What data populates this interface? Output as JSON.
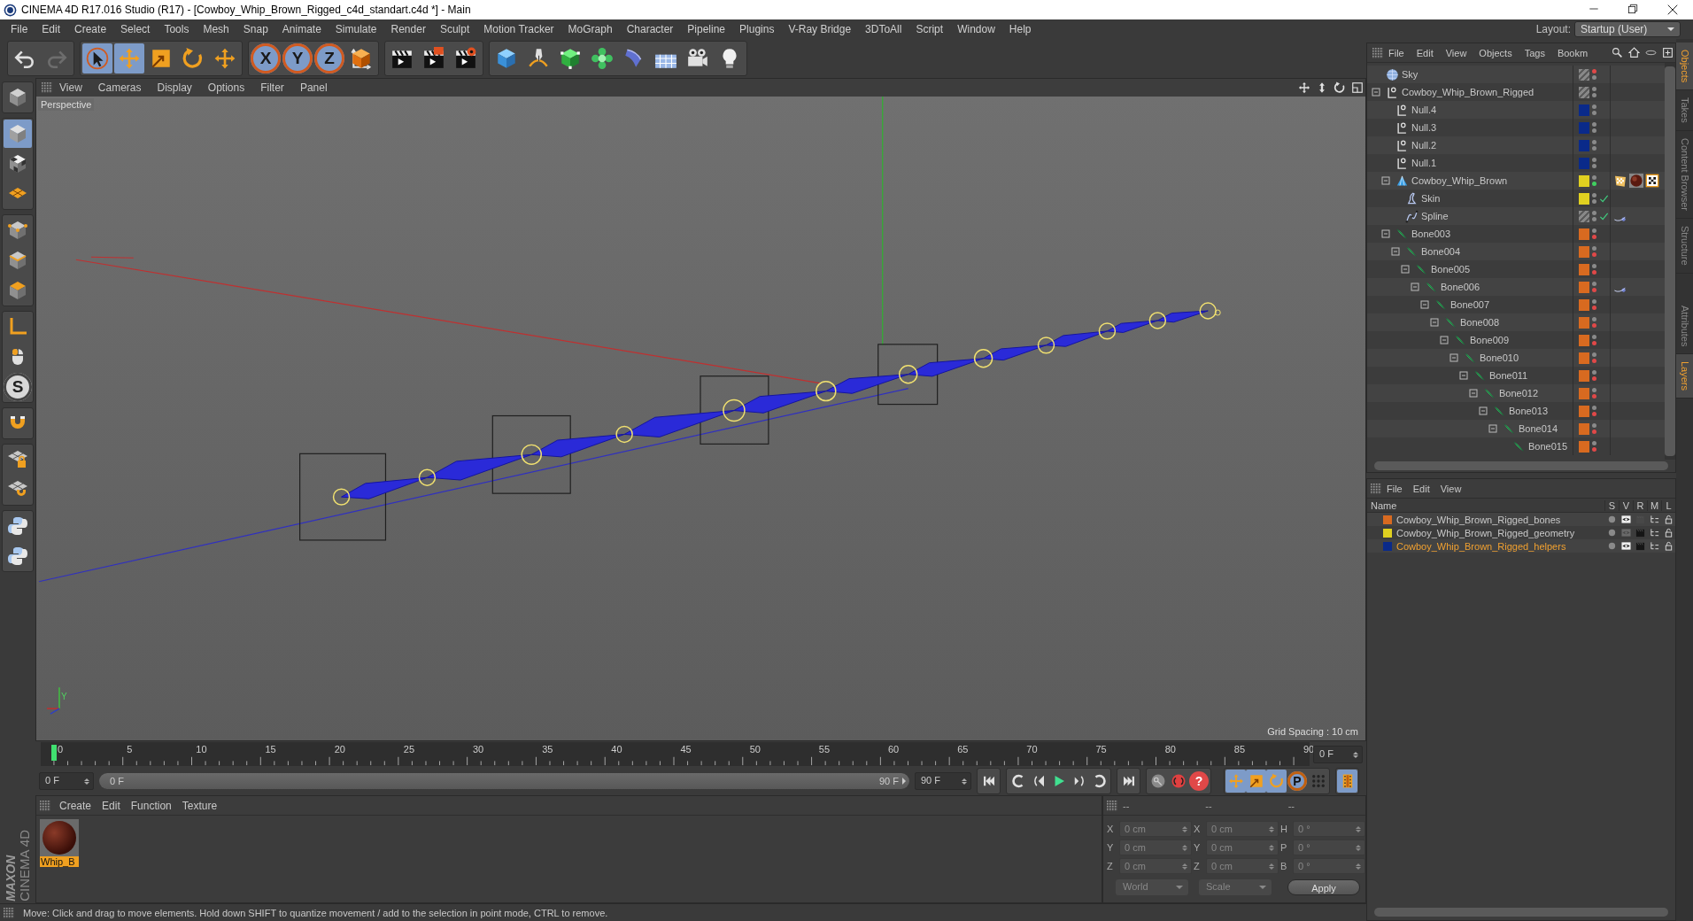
{
  "window": {
    "title": "CINEMA 4D R17.016 Studio (R17) - [Cowboy_Whip_Brown_Rigged_c4d_standart.c4d *] - Main"
  },
  "menu_bar": [
    "File",
    "Edit",
    "Create",
    "Select",
    "Tools",
    "Mesh",
    "Snap",
    "Animate",
    "Simulate",
    "Render",
    "Sculpt",
    "Motion Tracker",
    "MoGraph",
    "Character",
    "Pipeline",
    "Plugins",
    "V-Ray Bridge",
    "3DToAll",
    "Script",
    "Window",
    "Help"
  ],
  "layout": {
    "label": "Layout:",
    "value": "Startup (User)"
  },
  "toolbar": [
    [
      {
        "kind": "undo",
        "disabled": false
      },
      {
        "kind": "redo",
        "disabled": true
      }
    ],
    [
      {
        "kind": "select",
        "selected": true
      },
      {
        "kind": "move",
        "selected": true
      },
      {
        "kind": "scale",
        "selected": false
      },
      {
        "kind": "rotate",
        "selected": false
      },
      {
        "kind": "transform",
        "selected": false
      }
    ],
    [
      {
        "kind": "axislock",
        "label": "X",
        "selected": true
      },
      {
        "kind": "axislock",
        "label": "Y",
        "selected": true
      },
      {
        "kind": "axislock",
        "label": "Z",
        "selected": true
      },
      {
        "kind": "coords",
        "selected": false
      }
    ],
    [
      {
        "kind": "renderview"
      },
      {
        "kind": "renderpicture"
      },
      {
        "kind": "rendersettings"
      }
    ],
    [
      {
        "kind": "cube"
      },
      {
        "kind": "pen"
      },
      {
        "kind": "subdivision"
      },
      {
        "kind": "cloner"
      },
      {
        "kind": "deformer"
      },
      {
        "kind": "floor"
      },
      {
        "kind": "camera"
      },
      {
        "kind": "light"
      }
    ]
  ],
  "left_tools": [
    [
      {
        "kind": "editable",
        "selected": false
      }
    ],
    [
      {
        "kind": "model",
        "selected": true
      },
      {
        "kind": "texture",
        "selected": false
      },
      {
        "kind": "workplane",
        "selected": false
      }
    ],
    [
      {
        "kind": "points",
        "selected": false
      },
      {
        "kind": "edges",
        "selected": false
      },
      {
        "kind": "polygons",
        "selected": false
      }
    ],
    [
      {
        "kind": "axis",
        "selected": false
      },
      {
        "kind": "tweak",
        "selected": false
      },
      {
        "kind": "snap",
        "label": "S",
        "selected": false
      }
    ],
    [
      {
        "kind": "magnet",
        "selected": false
      }
    ],
    [
      {
        "kind": "locked",
        "selected": false
      },
      {
        "kind": "planar",
        "selected": false
      }
    ],
    [
      {
        "kind": "python",
        "selected": false
      },
      {
        "kind": "python",
        "selected": false
      }
    ]
  ],
  "branding": {
    "company": "MAXON",
    "product": "CINEMA 4D"
  },
  "viewport": {
    "menu": [
      "View",
      "Cameras",
      "Display",
      "Options",
      "Filter",
      "Panel"
    ],
    "camera": "Perspective",
    "grid_spacing": "Grid Spacing : 10 cm",
    "gizmo_label": "Y"
  },
  "timeline": {
    "ticks": [
      "0",
      "5",
      "10",
      "15",
      "20",
      "25",
      "30",
      "35",
      "40",
      "45",
      "50",
      "55",
      "60",
      "65",
      "70",
      "75",
      "80",
      "85",
      "90"
    ],
    "playhead": {
      "level": 0
    },
    "current_frame": "0 F",
    "start_field": "0 F",
    "range": {
      "start": "0 F",
      "end": "90 F",
      "level": 1
    },
    "end_field": "90 F",
    "controls": [
      [
        {
          "kind": "first"
        }
      ],
      [
        {
          "kind": "prevkey"
        },
        {
          "kind": "prevframe"
        },
        {
          "kind": "play"
        },
        {
          "kind": "nextframe"
        },
        {
          "kind": "nextkey"
        }
      ],
      [
        {
          "kind": "last"
        }
      ],
      [
        {
          "kind": "keyrecord"
        },
        {
          "kind": "record"
        },
        {
          "kind": "autokey",
          "label": "?"
        }
      ],
      [
        {
          "kind": "move",
          "selected": true
        },
        {
          "kind": "scale",
          "selected": true
        },
        {
          "kind": "rotate",
          "selected": true
        },
        {
          "kind": "param",
          "label": "P",
          "selected": true
        },
        {
          "kind": "dotgrid",
          "selected": false
        }
      ],
      [
        {
          "kind": "film",
          "selected": true
        }
      ]
    ]
  },
  "material_manager": {
    "menu": [
      "Create",
      "Edit",
      "Function",
      "Texture"
    ],
    "materials": [
      {
        "name": "Whip_B",
        "selected": true
      }
    ]
  },
  "coordinates": {
    "columns": [
      "--",
      "--",
      "--"
    ],
    "rows": [
      {
        "position_label": "X",
        "position": "0 cm",
        "size_label": "X",
        "size": "0 cm",
        "rotation_label": "H",
        "rotation": "0 °"
      },
      {
        "position_label": "Y",
        "position": "0 cm",
        "size_label": "Y",
        "size": "0 cm",
        "rotation_label": "P",
        "rotation": "0 °"
      },
      {
        "position_label": "Z",
        "position": "0 cm",
        "size_label": "Z",
        "size": "0 cm",
        "rotation_label": "B",
        "rotation": "0 °"
      }
    ],
    "space": "World",
    "mode": "Scale",
    "apply": "Apply"
  },
  "object_manager": {
    "menu": [
      "File",
      "Edit",
      "View",
      "Objects",
      "Tags",
      "Bookm"
    ],
    "tree": [
      {
        "name": "Sky",
        "kind": "sky",
        "editor_off": true,
        "render_on": false,
        "render_off": false
      },
      {
        "name": "Cowboy_Whip_Brown_Rigged",
        "kind": "null",
        "editor_off": false,
        "render_on": false,
        "render_off": false,
        "expanded": true,
        "children": [
          {
            "name": "Null.4",
            "kind": "null",
            "color": "#0a2a8a",
            "editor_off": false,
            "render_on": false,
            "render_off": false
          },
          {
            "name": "Null.3",
            "kind": "null",
            "color": "#0a2a8a",
            "editor_off": false,
            "render_on": false,
            "render_off": false
          },
          {
            "name": "Null.2",
            "kind": "null",
            "color": "#0a2a8a",
            "editor_off": false,
            "render_on": false,
            "render_off": false
          },
          {
            "name": "Null.1",
            "kind": "null",
            "color": "#0a2a8a",
            "editor_off": false,
            "render_on": false,
            "render_off": false
          },
          {
            "name": "Cowboy_Whip_Brown",
            "kind": "mesh",
            "color": "#e0d020",
            "editor_off": false,
            "render_on": true,
            "render_off": false,
            "expanded": true,
            "tags": [
              {
                "kind": "texture"
              },
              {
                "kind": "material"
              },
              {
                "kind": "checker"
              }
            ],
            "children": [
              {
                "name": "Skin",
                "kind": "skin",
                "color": "#e0d020",
                "editor_off": false,
                "render_on": false,
                "render_off": false,
                "enabled": true
              },
              {
                "name": "Spline",
                "kind": "spline",
                "editor_off": false,
                "render_on": false,
                "render_off": false,
                "enabled": true,
                "tags": [
                  {
                    "kind": "ik"
                  }
                ]
              }
            ]
          },
          {
            "name": "Bone003",
            "kind": "bone",
            "color": "#d86a20",
            "editor_off": false,
            "render_on": false,
            "render_off": true,
            "expanded": true,
            "children": [
              {
                "name": "Bone004",
                "kind": "bone",
                "color": "#d86a20",
                "editor_off": false,
                "render_on": false,
                "render_off": true,
                "expanded": true,
                "children": [
                  {
                    "name": "Bone005",
                    "kind": "bone",
                    "color": "#d86a20",
                    "editor_off": false,
                    "render_on": false,
                    "render_off": true,
                    "expanded": true,
                    "children": [
                      {
                        "name": "Bone006",
                        "kind": "bone",
                        "color": "#d86a20",
                        "editor_off": false,
                        "render_on": false,
                        "render_off": true,
                        "expanded": true,
                        "tags": [
                          {
                            "kind": "ik"
                          }
                        ],
                        "children": [
                          {
                            "name": "Bone007",
                            "kind": "bone",
                            "color": "#d86a20",
                            "editor_off": false,
                            "render_on": false,
                            "render_off": true,
                            "expanded": true,
                            "children": [
                              {
                                "name": "Bone008",
                                "kind": "bone",
                                "color": "#d86a20",
                                "editor_off": false,
                                "render_on": false,
                                "render_off": true,
                                "expanded": true,
                                "children": [
                                  {
                                    "name": "Bone009",
                                    "kind": "bone",
                                    "color": "#d86a20",
                                    "editor_off": false,
                                    "render_on": false,
                                    "render_off": true,
                                    "expanded": true,
                                    "children": [
                                      {
                                        "name": "Bone010",
                                        "kind": "bone",
                                        "color": "#d86a20",
                                        "editor_off": false,
                                        "render_on": false,
                                        "render_off": true,
                                        "expanded": true,
                                        "children": [
                                          {
                                            "name": "Bone011",
                                            "kind": "bone",
                                            "color": "#d86a20",
                                            "editor_off": false,
                                            "render_on": false,
                                            "render_off": true,
                                            "expanded": true,
                                            "children": [
                                              {
                                                "name": "Bone012",
                                                "kind": "bone",
                                                "color": "#d86a20",
                                                "editor_off": false,
                                                "render_on": false,
                                                "render_off": true,
                                                "expanded": true,
                                                "children": [
                                                  {
                                                    "name": "Bone013",
                                                    "kind": "bone",
                                                    "color": "#d86a20",
                                                    "editor_off": false,
                                                    "render_on": false,
                                                    "render_off": true,
                                                    "expanded": true,
                                                    "children": [
                                                      {
                                                        "name": "Bone014",
                                                        "kind": "bone",
                                                        "color": "#d86a20",
                                                        "editor_off": false,
                                                        "render_on": false,
                                                        "render_off": true,
                                                        "expanded": true,
                                                        "children": [
                                                          {
                                                            "name": "Bone015",
                                                            "kind": "bone",
                                                            "color": "#d86a20",
                                                            "editor_off": false,
                                                            "render_on": false,
                                                            "render_off": true
                                                          }
                                                        ]
                                                      }
                                                    ]
                                                  }
                                                ]
                                              }
                                            ]
                                          }
                                        ]
                                      }
                                    ]
                                  }
                                ]
                              }
                            ]
                          }
                        ]
                      }
                    ]
                  }
                ]
              }
            ]
          }
        ]
      }
    ]
  },
  "layer_manager": {
    "menu": [
      "File",
      "Edit",
      "View"
    ],
    "columns": [
      "Name",
      "S",
      "V",
      "R",
      "M",
      "L"
    ],
    "layers": [
      {
        "name": "Cowboy_Whip_Brown_Rigged_bones",
        "color": "#d86a20",
        "selected": false,
        "view": true,
        "render": false
      },
      {
        "name": "Cowboy_Whip_Brown_Rigged_geometry",
        "color": "#e0d020",
        "selected": false,
        "view": false,
        "render": true
      },
      {
        "name": "Cowboy_Whip_Brown_Rigged_helpers",
        "color": "#0a2a8a",
        "selected": true,
        "view": true,
        "render": true
      }
    ]
  },
  "side_tabs": [
    {
      "label": "Objects",
      "selected": true
    },
    {
      "label": "Takes",
      "selected": false
    },
    {
      "label": "Content Browser",
      "selected": false
    },
    {
      "label": "Structure",
      "selected": false
    }
  ],
  "side_tabs_lower": [
    {
      "label": "Attributes",
      "selected": false
    },
    {
      "label": "Layers",
      "selected": true
    }
  ],
  "status_bar": "Move: Click and drag to move elements. Hold down SHIFT to quantize movement / add to the selection in point mode, CTRL to remove."
}
